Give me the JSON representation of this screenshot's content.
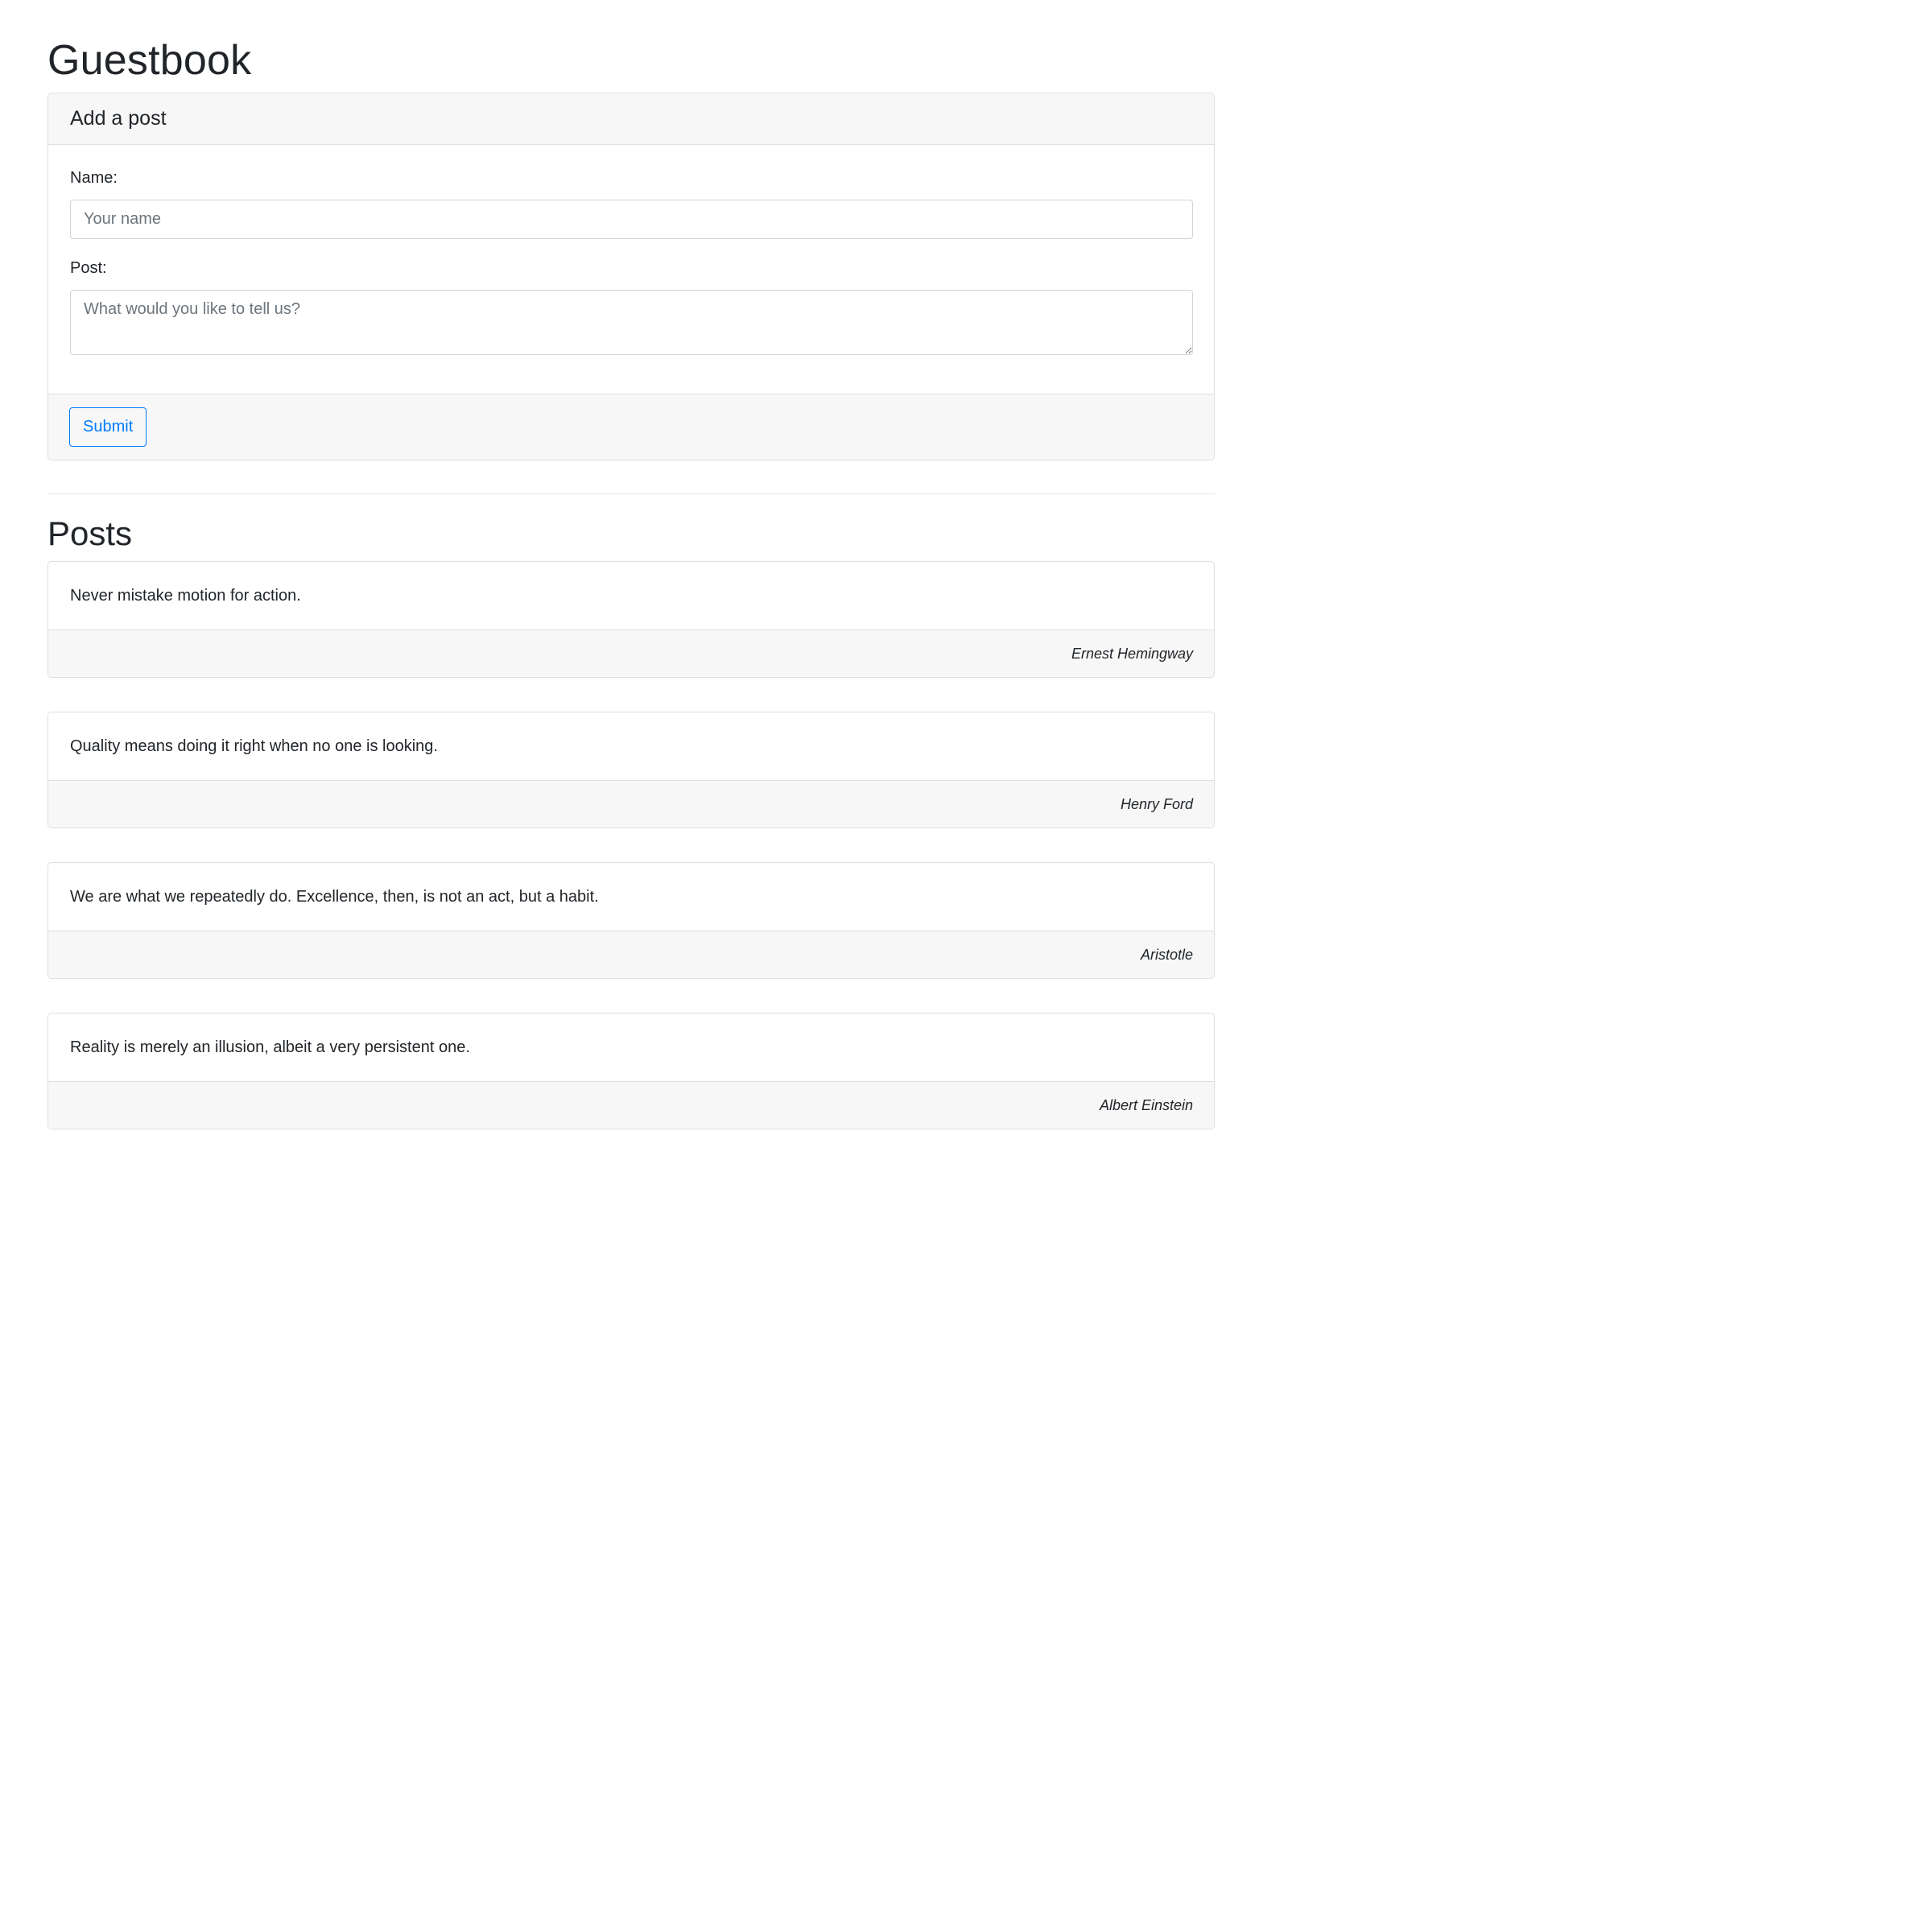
{
  "page": {
    "title": "Guestbook"
  },
  "form": {
    "header": "Add a post",
    "name_label": "Name:",
    "name_placeholder": "Your name",
    "name_value": "",
    "post_label": "Post:",
    "post_placeholder": "What would you like to tell us?",
    "post_value": "",
    "submit_label": "Submit"
  },
  "posts_section": {
    "title": "Posts"
  },
  "posts": [
    {
      "text": "Never mistake motion for action.",
      "author": "Ernest Hemingway"
    },
    {
      "text": "Quality means doing it right when no one is looking.",
      "author": "Henry Ford"
    },
    {
      "text": "We are what we repeatedly do. Excellence, then, is not an act, but a habit.",
      "author": "Aristotle"
    },
    {
      "text": "Reality is merely an illusion, albeit a very persistent one.",
      "author": "Albert Einstein"
    }
  ],
  "colors": {
    "primary": "#007bff",
    "card_bg": "#f7f7f7",
    "border": "#dfdfdf",
    "text": "#212529"
  }
}
